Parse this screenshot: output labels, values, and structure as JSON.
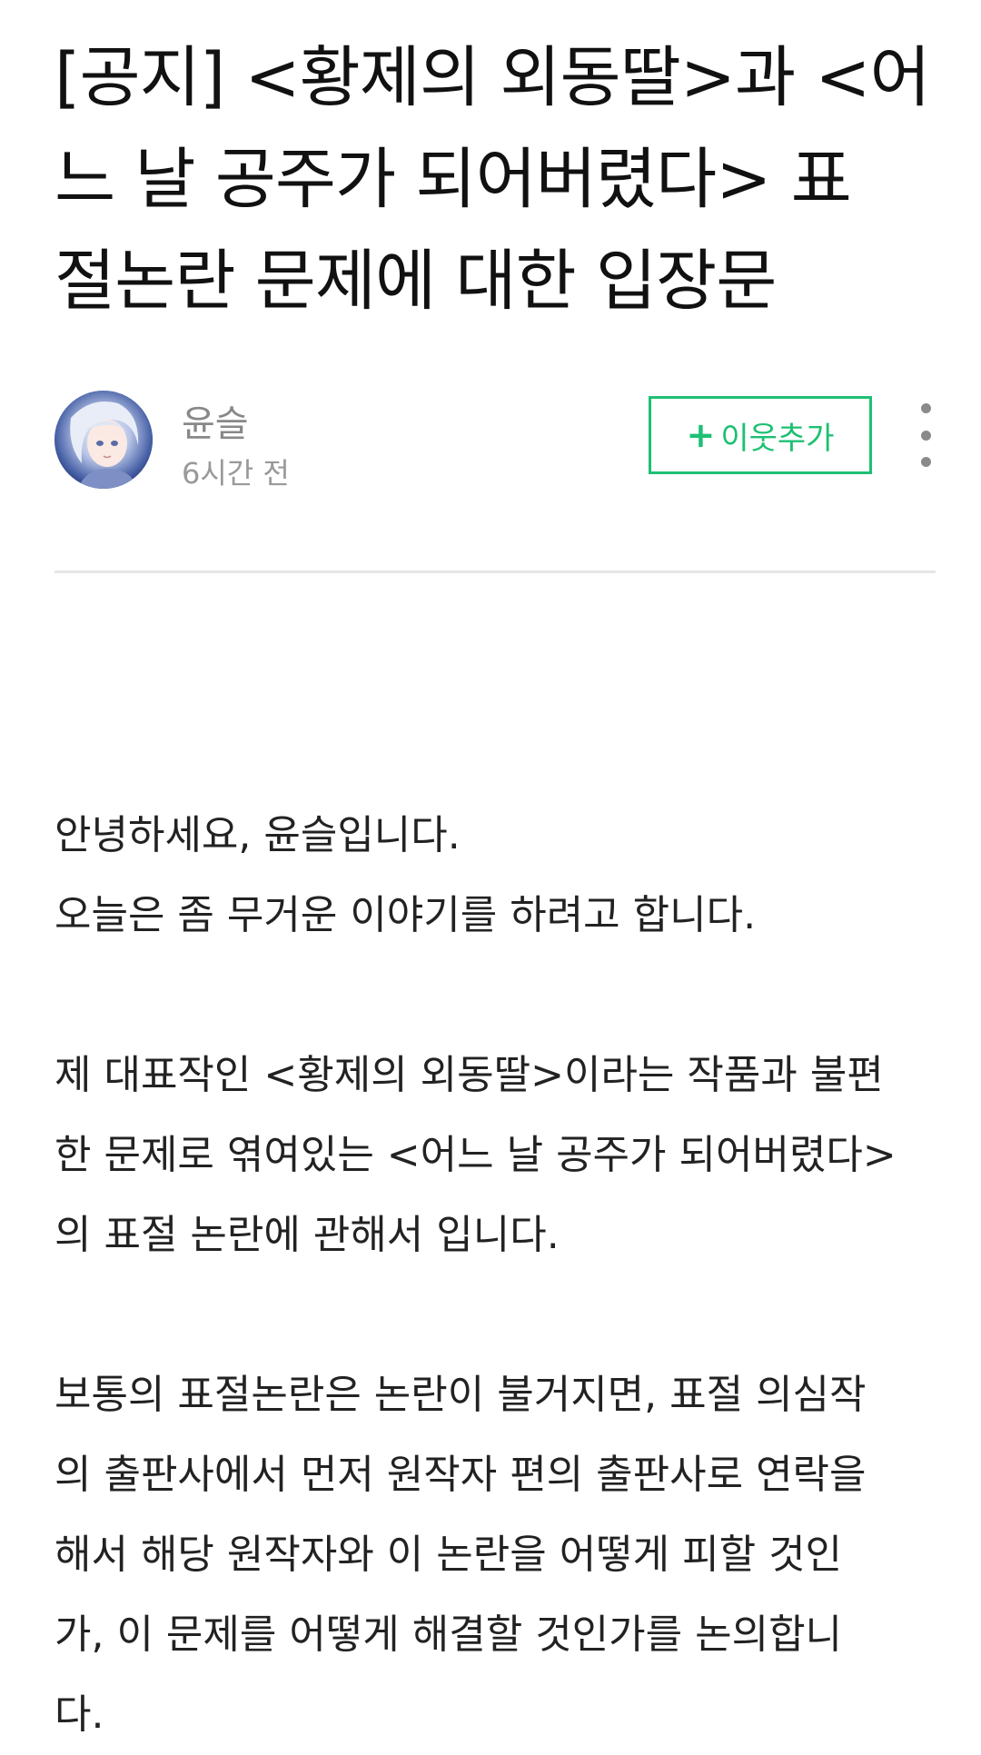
{
  "post": {
    "title_lines": [
      "[공지] <황제의 외동딸>과 <어",
      "느 날 공주가 되어버렸다> 표",
      "절논란 문제에 대한 입장문"
    ]
  },
  "author": {
    "name": "윤슬",
    "time": "6시간 전"
  },
  "actions": {
    "follow_plus": "+",
    "follow_label": "이웃추가"
  },
  "content": {
    "paragraphs": [
      [
        "안녕하세요, 윤슬입니다.",
        "오늘은 좀 무거운 이야기를 하려고 합니다."
      ],
      [
        "제 대표작인 <황제의 외동딸>이라는 작품과 불편",
        "한 문제로 엮여있는 <어느 날 공주가 되어버렸다>",
        "의 표절 논란에 관해서 입니다."
      ],
      [
        "보통의 표절논란은 논란이 불거지면, 표절 의심작",
        "의 출판사에서 먼저 원작자 편의 출판사로 연락을",
        "해서 해당 원작자와 이 논란을 어떻게 피할 것인",
        "가, 이 문제를 어떻게 해결할 것인가를 논의합니",
        "다."
      ]
    ]
  },
  "colors": {
    "accent": "#1ec073",
    "text": "#111111",
    "meta": "#999999",
    "divider": "#e6e6e6"
  },
  "icons": {
    "more": "more-vertical-icon",
    "plus": "plus-icon"
  }
}
